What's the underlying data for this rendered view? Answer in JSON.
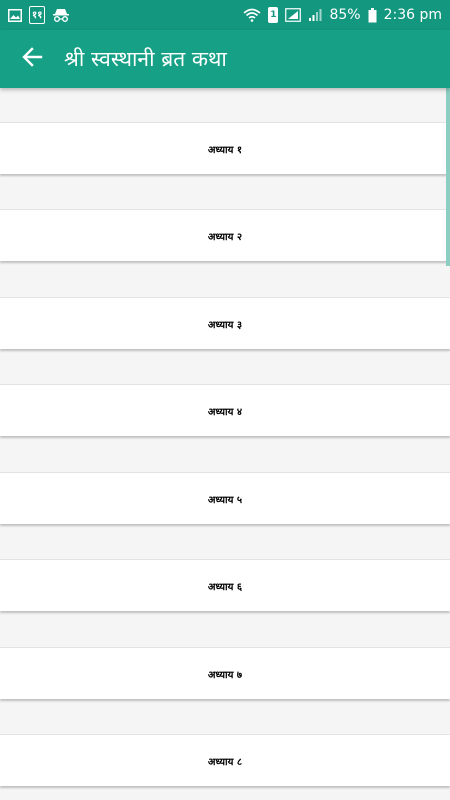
{
  "status_bar": {
    "left_badge": "११",
    "battery_percent": "85%",
    "sim_slot": "1",
    "time": "2:36 pm"
  },
  "app_bar": {
    "title": "श्री स्वस्थानी ब्रत कथा",
    "back_icon": "arrow-left-icon"
  },
  "chapters": [
    {
      "label": "अध्याय १"
    },
    {
      "label": "अध्याय २"
    },
    {
      "label": "अध्याय ३"
    },
    {
      "label": "अध्याय ४"
    },
    {
      "label": "अध्याय ५"
    },
    {
      "label": "अध्याय ६"
    },
    {
      "label": "अध्याय ७"
    },
    {
      "label": "अध्याय ८"
    }
  ],
  "colors": {
    "app_bar": "#16a085",
    "status_bar": "#14977f",
    "background": "#f5f5f5"
  }
}
